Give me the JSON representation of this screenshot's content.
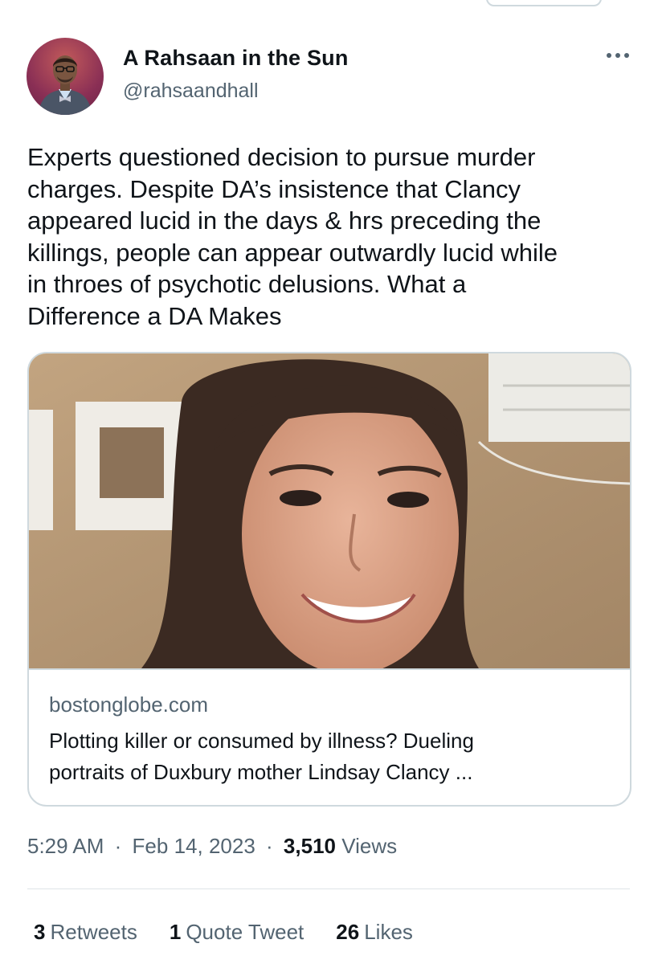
{
  "tweet": {
    "author_name": "A Rahsaan in the Sun",
    "author_handle": "@rahsaandhall",
    "text": "Experts questioned decision to pursue murder\ncharges. Despite DA’s insistence that Clancy\nappeared lucid in the days & hrs preceding the\nkillings, people can appear outwardly lucid while\nin throes of psychotic delusions. What a\nDifference a DA Makes",
    "more_icon": "ellipsis-icon"
  },
  "link_card": {
    "domain": "bostonglobe.com",
    "title": "Plotting killer or consumed by illness? Dueling\nportraits of Duxbury mother Lindsay Clancy ..."
  },
  "meta": {
    "time": "5:29 AM",
    "date": "Feb 14, 2023",
    "separator": "·",
    "views_count": "3,510",
    "views_label": "Views"
  },
  "stats": {
    "retweets_count": "3",
    "retweets_label": "Retweets",
    "quotes_count": "1",
    "quotes_label": "Quote Tweet",
    "likes_count": "26",
    "likes_label": "Likes"
  },
  "colors": {
    "text_primary": "#0f1419",
    "text_secondary": "#536471",
    "border": "#cfd9de"
  }
}
